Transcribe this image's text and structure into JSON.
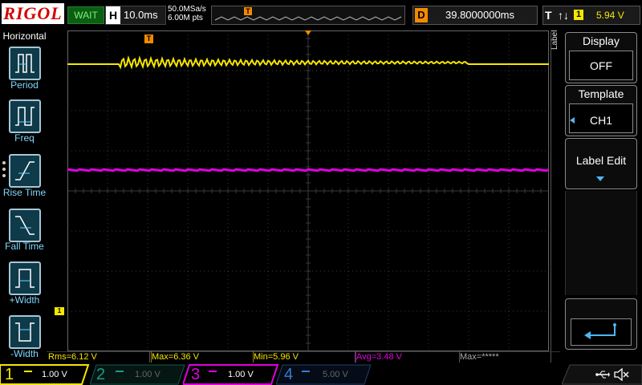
{
  "brand": "RIGOL",
  "run_state": "WAIT",
  "horizontal": {
    "label": "H",
    "timebase": "10.0ms"
  },
  "acquisition": {
    "sample_rate": "50.0MSa/s",
    "memory_depth": "6.00M pts"
  },
  "trigger_marker": "T",
  "delay": {
    "label": "D",
    "value": "39.8000000ms"
  },
  "trigger": {
    "label": "T",
    "slope_symbol": "↑↓",
    "source_channel": "1",
    "level": "5.94 V"
  },
  "left_menu": {
    "title": "Horizontal",
    "items": [
      {
        "label": "Period",
        "icon": "period-icon"
      },
      {
        "label": "Freq",
        "icon": "frequency-icon"
      },
      {
        "label": "Rise Time",
        "icon": "rise-time-icon"
      },
      {
        "label": "Fall Time",
        "icon": "fall-time-icon"
      },
      {
        "label": "+Width",
        "icon": "positive-width-icon"
      },
      {
        "label": "-Width",
        "icon": "negative-width-icon"
      }
    ]
  },
  "right_menu": {
    "side_tab": "Label",
    "display": {
      "title": "Display",
      "value": "OFF"
    },
    "template": {
      "title": "Template",
      "value": "CH1"
    },
    "label_edit": {
      "title": "Label Edit"
    },
    "return_icon": "return-arrow-icon"
  },
  "ch1_ground_marker": "1",
  "measurements": [
    {
      "text": "Rms=6.12 V",
      "color": "#f5e600"
    },
    {
      "text": "Max=6.36 V",
      "color": "#f5e600"
    },
    {
      "text": "Min=5.96 V",
      "color": "#f5e600"
    },
    {
      "text": "Avg=3.48 V",
      "color": "#e000e0"
    },
    {
      "text": "Max=*****",
      "color": "#aaaaaa"
    }
  ],
  "channels": [
    {
      "number": "1",
      "scale": "1.00 V",
      "color": "#f5e600",
      "active": true
    },
    {
      "number": "2",
      "scale": "1.00 V",
      "color": "#1f9a8a",
      "active": false
    },
    {
      "number": "3",
      "scale": "1.00 V",
      "color": "#e000e0",
      "active": true
    },
    {
      "number": "4",
      "scale": "5.00 V",
      "color": "#3a7bd5",
      "active": false
    }
  ],
  "status_icons": [
    "usb-icon",
    "speaker-muted-icon"
  ],
  "colors": {
    "ch1": "#f5e600",
    "ch3": "#e000e0",
    "accent": "#f28a00",
    "grid": "#3a3a3a"
  }
}
